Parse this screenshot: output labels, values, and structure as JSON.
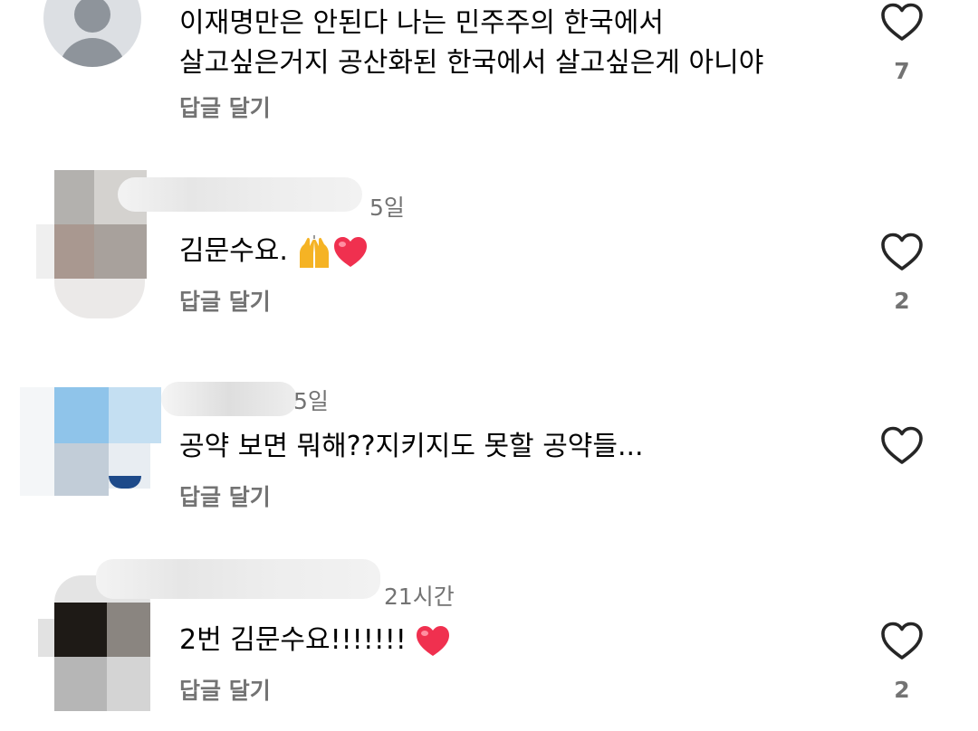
{
  "comments": [
    {
      "time": "",
      "text_line1": "이재명만은 안된다 나는 민주주의 한국에서",
      "text_line2": "살고싶은거지 공산화된 한국에서 살고싶은게 아니야",
      "reply_label": "답글 달기",
      "like_count": "7"
    },
    {
      "time": "5일",
      "text": "김문수요.",
      "emojis": [
        "raising-hands-emoji",
        "heart-emoji"
      ],
      "reply_label": "답글 달기",
      "like_count": "2"
    },
    {
      "time": "5일",
      "text": "공약 보면 뭐해??지키지도 못할 공약들...",
      "reply_label": "답글 달기",
      "like_count": ""
    },
    {
      "time": "21시간",
      "text": "2번 김문수요!!!!!!!",
      "emojis": [
        "heart-emoji"
      ],
      "reply_label": "답글 달기",
      "like_count": "2"
    }
  ],
  "icons": {
    "like": "heart-outline-icon",
    "avatar_default": "default-avatar-icon"
  },
  "colors": {
    "text": "#000000",
    "secondary": "#737373",
    "heart_emoji": "#f0304f",
    "hands_emoji": "#f5b324"
  }
}
